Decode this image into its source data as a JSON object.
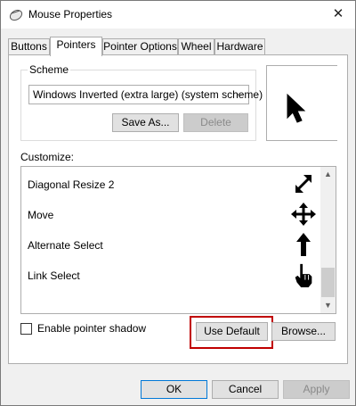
{
  "window": {
    "title": "Mouse Properties",
    "close_glyph": "✕"
  },
  "tabs": [
    {
      "label": "Buttons"
    },
    {
      "label": "Pointers"
    },
    {
      "label": "Pointer Options"
    },
    {
      "label": "Wheel"
    },
    {
      "label": "Hardware"
    }
  ],
  "active_tab": "Pointers",
  "scheme": {
    "label": "Scheme",
    "value": "Windows Inverted (extra large) (system scheme)",
    "save_as_label": "Save As...",
    "delete_label": "Delete"
  },
  "customize": {
    "label": "Customize:",
    "items": [
      {
        "name": "Diagonal Resize 2",
        "icon": "diagonal-resize-icon"
      },
      {
        "name": "Move",
        "icon": "move-icon"
      },
      {
        "name": "Alternate Select",
        "icon": "up-arrow-icon"
      },
      {
        "name": "Link Select",
        "icon": "hand-pointer-icon"
      }
    ]
  },
  "pointer_shadow": {
    "label": "Enable pointer shadow",
    "checked": false
  },
  "buttons": {
    "use_default": "Use Default",
    "browse": "Browse...",
    "ok": "OK",
    "cancel": "Cancel",
    "apply": "Apply"
  },
  "colors": {
    "highlight": "#c00000",
    "focus_border": "#0078d7"
  }
}
